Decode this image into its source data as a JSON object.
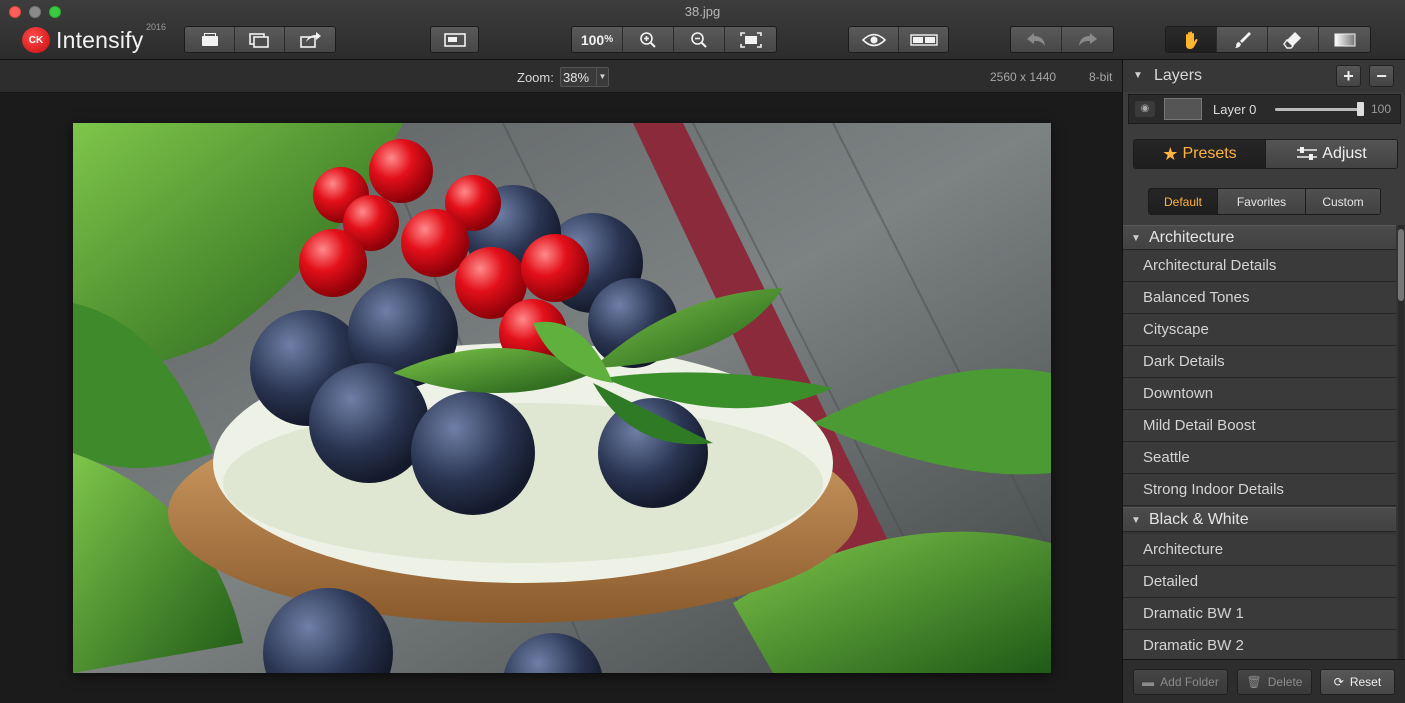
{
  "window": {
    "title": "38.jpg",
    "brand": {
      "logo": "CK",
      "name": "Intensify",
      "year": "2016"
    }
  },
  "toolbar": {
    "file_group": [
      {
        "icon": "open-icon"
      },
      {
        "icon": "batch-icon"
      },
      {
        "icon": "share-icon"
      }
    ],
    "panel_toggle_icon": "window-layout-icon",
    "zoom_group": {
      "actual_size_label": "100",
      "actual_size_suffix": "%",
      "zoom_in_icon": "zoom-in-icon",
      "zoom_out_icon": "zoom-out-icon",
      "fit_icon": "fit-screen-icon"
    },
    "view_group": [
      {
        "icon": "eye-icon"
      },
      {
        "icon": "compare-icon"
      }
    ],
    "history_group": [
      {
        "icon": "undo-icon",
        "enabled": false
      },
      {
        "icon": "redo-icon",
        "enabled": false
      }
    ],
    "tools_group": [
      {
        "icon": "hand-tool-icon",
        "active": true
      },
      {
        "icon": "brush-tool-icon",
        "active": false
      },
      {
        "icon": "eraser-tool-icon",
        "active": false
      },
      {
        "icon": "gradient-tool-icon",
        "active": false
      }
    ],
    "accent_color": "#ffb52e"
  },
  "infobar": {
    "zoom_label": "Zoom:",
    "zoom_value": "38%",
    "dimensions": "2560 x 1440",
    "bit_depth": "8-bit"
  },
  "layers": {
    "title": "Layers",
    "add_label": "+",
    "remove_label": "−",
    "items": [
      {
        "name": "Layer 0",
        "opacity": "100",
        "opacity_fraction": 1.0,
        "visible": true
      }
    ]
  },
  "mode_tabs": [
    {
      "label": "Presets",
      "icon": "star-icon",
      "active": true
    },
    {
      "label": "Adjust",
      "icon": "sliders-icon",
      "active": false
    }
  ],
  "preset_tabs": [
    {
      "label": "Default",
      "active": true
    },
    {
      "label": "Favorites",
      "active": false
    },
    {
      "label": "Custom",
      "active": false
    }
  ],
  "preset_groups": [
    {
      "name": "Architecture",
      "items": [
        "Architectural Details",
        "Balanced Tones",
        "Cityscape",
        "Dark Details",
        "Downtown",
        "Mild Detail Boost",
        "Seattle",
        "Strong Indoor Details"
      ]
    },
    {
      "name": "Black & White",
      "items": [
        "Architecture",
        "Detailed",
        "Dramatic BW 1",
        "Dramatic BW 2"
      ]
    }
  ],
  "bottom_buttons": {
    "add_folder": "Add Folder",
    "delete": "Delete",
    "reset": "Reset"
  }
}
